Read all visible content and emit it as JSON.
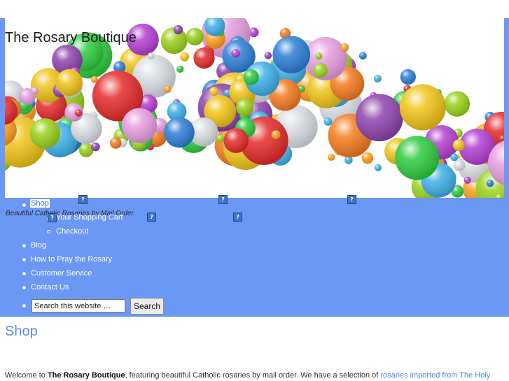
{
  "site": {
    "title": "The Rosary Boutique",
    "tagline": "Beautiful Catholic Rosaries by Mail Order"
  },
  "nav": {
    "items": [
      {
        "label": "Shop"
      },
      {
        "label": "Your Shopping Cart"
      },
      {
        "label": "Checkout"
      },
      {
        "label": "Blog"
      },
      {
        "label": "How to Pray the Rosary"
      },
      {
        "label": "Customer Service"
      },
      {
        "label": "Contact Us"
      }
    ],
    "search": {
      "value": "Search this website …",
      "button": "Search"
    },
    "broken_image_glyph": "?"
  },
  "main": {
    "title": "Shop",
    "intro": {
      "prefix": "Welcome to ",
      "brand": "The Rosary Boutique",
      "middle": ", featuring beautiful Catholic rosaries by mail order. We have a selection of ",
      "link": "rosaries imported from The Holy"
    }
  },
  "colors": {
    "page_bg": "#6b97f5",
    "link": "#4a86e0"
  }
}
